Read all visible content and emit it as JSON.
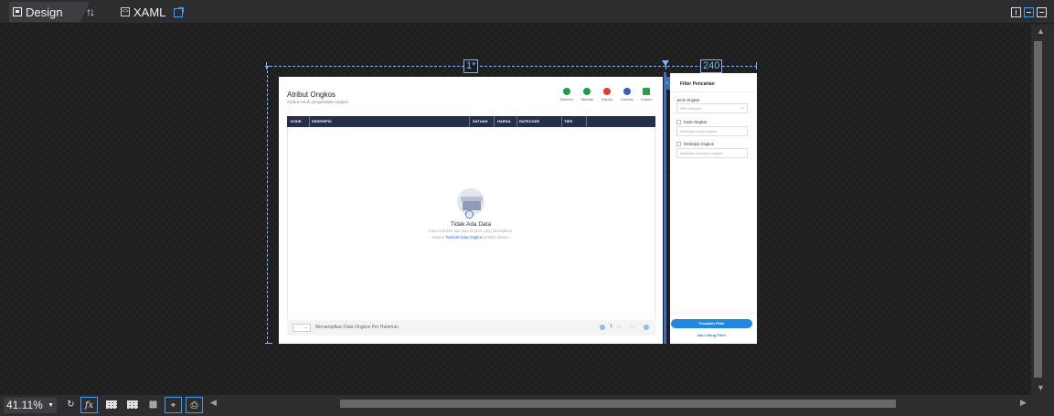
{
  "editor": {
    "design_tab": "Design",
    "xaml_tab": "XAML",
    "zoom": "41.11%"
  },
  "layout": {
    "col1_width": "1*",
    "col2_width": "240"
  },
  "page": {
    "title": "Atribut Ongkos",
    "subtitle": "Atribut untuk pengelolaan ongkos"
  },
  "toolbar": [
    {
      "label": "Refresh",
      "color": "#1e9e4a"
    },
    {
      "label": "Tambah",
      "color": "#1e9e4a"
    },
    {
      "label": "Hapus",
      "color": "#e53935"
    },
    {
      "label": "Koreksi",
      "color": "#3a5bbf"
    },
    {
      "label": "Export",
      "color": "#2e9e4a"
    }
  ],
  "grid": {
    "columns": [
      "KODE",
      "DESKRIPSI",
      "SATUAN",
      "HARGA",
      "RATECODE",
      "TIER"
    ]
  },
  "empty_state": {
    "title": "Tidak Ada Data",
    "line1": "Saat ini belum ada data ongkos yang ditampilkan.",
    "line2_prefix": "Silakan",
    "line2_link": "Tambah Data Ongkos",
    "line2_suffix": "terlebih dahulu."
  },
  "pager": {
    "per_page_text": "Menampilkan Data Ongkos Per Halaman",
    "page_current": "1",
    "ellipsis": "..."
  },
  "filter": {
    "title": "Filter Pencarian",
    "category_label": "Jenis Ongkos",
    "category_placeholder": "Pilih kategori",
    "code_label": "Kode Ongkos",
    "code_placeholder": "Masukan kode ongkos",
    "desc_label": "Deskripsi Ongkos",
    "desc_placeholder": "Masukan deskripsi ongkos",
    "apply_label": "Terapkan Filter",
    "reset_label": "Atur Ulang Filter"
  }
}
